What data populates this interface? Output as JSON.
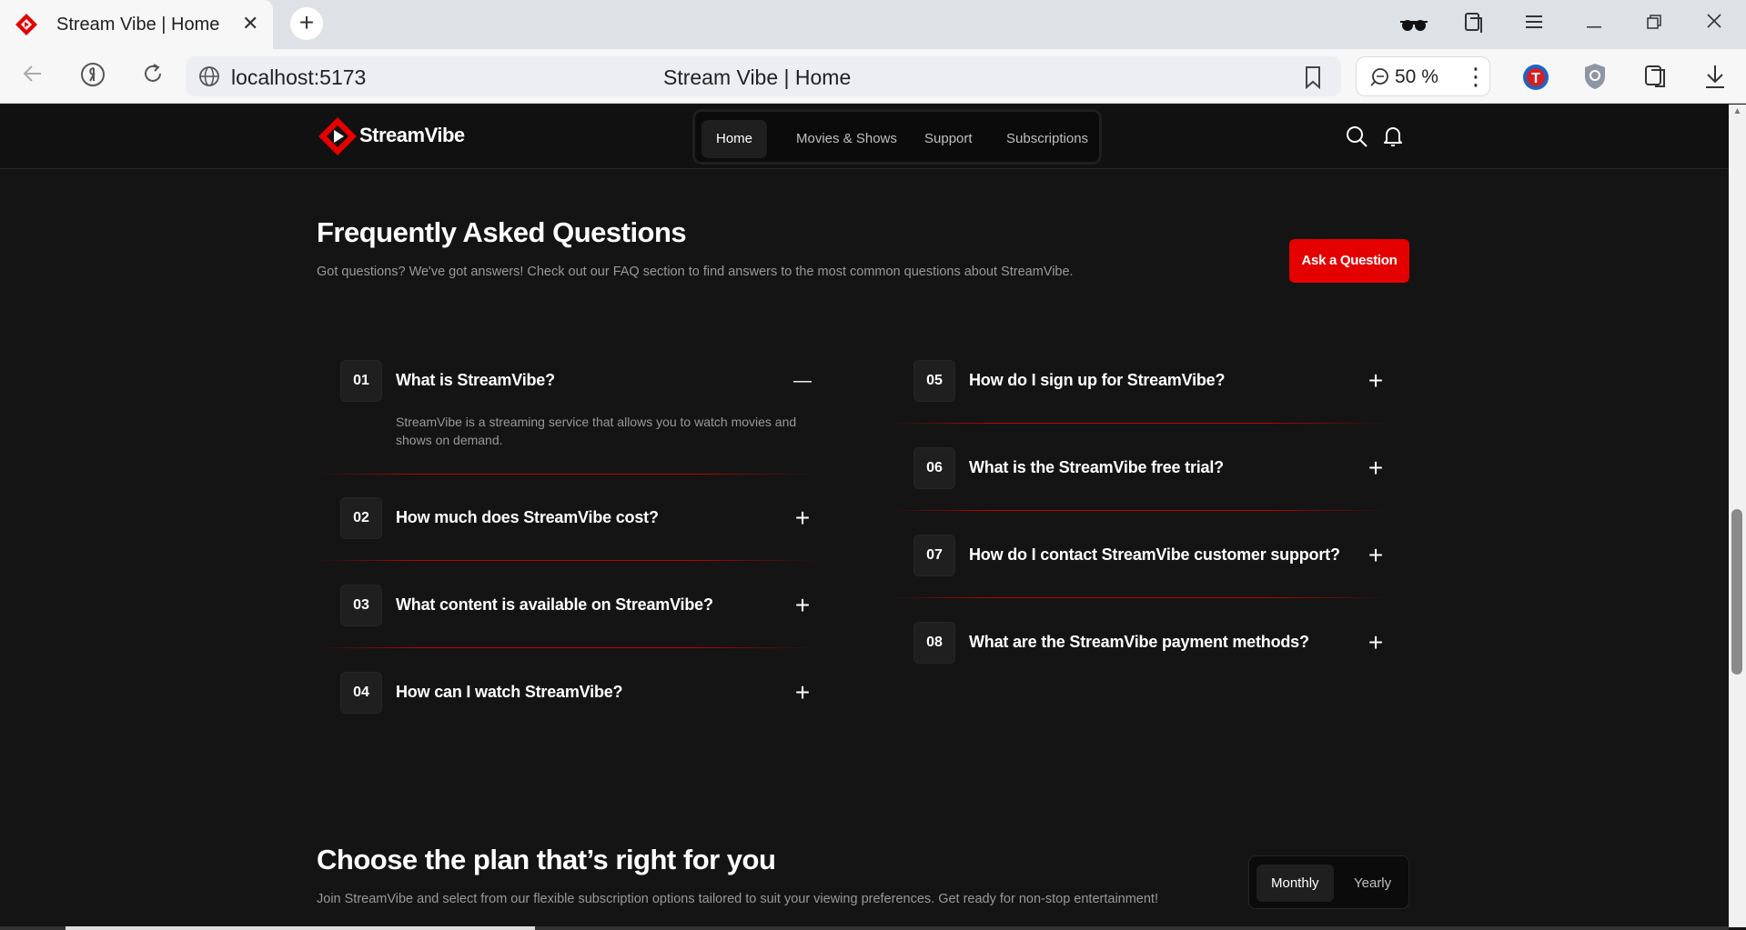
{
  "browser": {
    "tab_title": "Stream Vibe | Home",
    "tab_close": "✕",
    "new_tab": "+",
    "url": "localhost:5173",
    "page_title": "Stream Vibe | Home",
    "zoom": "50 %",
    "more": "⋮"
  },
  "header": {
    "logo_text": "StreamVibe",
    "nav": [
      {
        "label": "Home",
        "active": true
      },
      {
        "label": "Movies & Shows",
        "active": false
      },
      {
        "label": "Support",
        "active": false
      },
      {
        "label": "Subscriptions",
        "active": false
      }
    ]
  },
  "faq": {
    "title": "Frequently Asked Questions",
    "subtitle": "Got questions? We've got answers! Check out our FAQ section to find answers to the most common questions about StreamVibe.",
    "ask_button": "Ask a Question",
    "items": [
      {
        "num": "01",
        "question": "What is StreamVibe?",
        "toggle": "—",
        "answer": "StreamVibe is a streaming service that allows you to watch movies and shows on demand."
      },
      {
        "num": "02",
        "question": "How much does StreamVibe cost?",
        "toggle": "+"
      },
      {
        "num": "03",
        "question": "What content is available on StreamVibe?",
        "toggle": "+"
      },
      {
        "num": "04",
        "question": "How can I watch StreamVibe?",
        "toggle": "+"
      },
      {
        "num": "05",
        "question": "How do I sign up for StreamVibe?",
        "toggle": "+"
      },
      {
        "num": "06",
        "question": "What is the StreamVibe free trial?",
        "toggle": "+"
      },
      {
        "num": "07",
        "question": "How do I contact StreamVibe customer support?",
        "toggle": "+"
      },
      {
        "num": "08",
        "question": "What are the StreamVibe payment methods?",
        "toggle": "+"
      }
    ]
  },
  "plans": {
    "title": "Choose the plan that’s right for you",
    "subtitle": "Join StreamVibe and select from our flexible subscription options tailored to suit your viewing preferences. Get ready for non-stop entertainment!",
    "billing": [
      {
        "label": "Monthly",
        "active": true
      },
      {
        "label": "Yearly",
        "active": false
      }
    ]
  },
  "colors": {
    "accent": "#e50000",
    "background": "#141414",
    "card": "#1f1f1f"
  }
}
